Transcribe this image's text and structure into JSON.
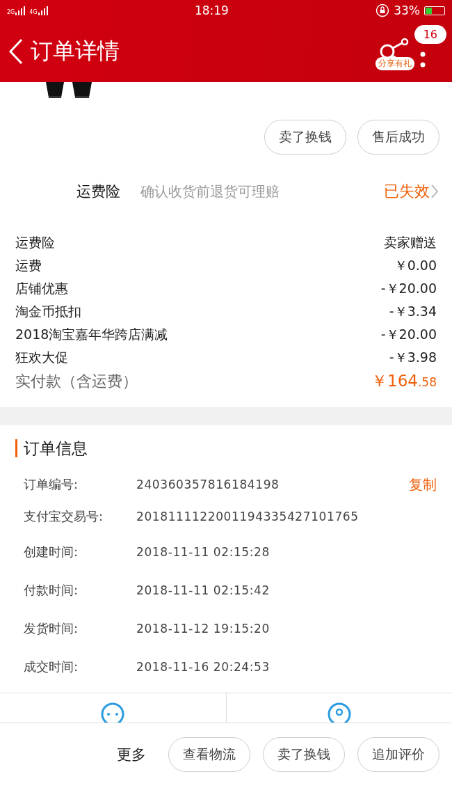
{
  "status_bar": {
    "network_1": "2G",
    "network_2": "4G",
    "time": "18:19",
    "battery": "33%"
  },
  "header": {
    "title": "订单详情",
    "share_label": "分享有礼",
    "badge": "16"
  },
  "product_actions": [
    "卖了换钱",
    "售后成功"
  ],
  "insurance": {
    "label": "运费险",
    "description": "确认收货前退货可理赔",
    "status": "已失效"
  },
  "price_rows": [
    {
      "label": "运费险",
      "value": "卖家赠送"
    },
    {
      "label": "运费",
      "value": "￥0.00"
    },
    {
      "label": "店铺优惠",
      "value": "-￥20.00"
    },
    {
      "label": "淘金币抵扣",
      "value": "-￥3.34"
    },
    {
      "label": "2018淘宝嘉年华跨店满减",
      "value": "-￥20.00"
    },
    {
      "label": "狂欢大促",
      "value": "-￥3.98"
    }
  ],
  "total": {
    "label": "实付款（含运费）",
    "amount": "￥164",
    "fraction": ".58"
  },
  "order_info": {
    "title": "订单信息",
    "rows": [
      {
        "label": "订单编号:",
        "value": "240360357816184198",
        "action": "复制"
      },
      {
        "label": "支付宝交易号:",
        "value": "2018111122001194335427101765"
      },
      {
        "label": "创建时间:",
        "value": "2018-11-11 02:15:28"
      },
      {
        "label": "付款时间:",
        "value": "2018-11-11 02:15:42"
      },
      {
        "label": "发货时间:",
        "value": "2018-11-12 19:15:20"
      },
      {
        "label": "成交时间:",
        "value": "2018-11-16 20:24:53"
      }
    ]
  },
  "bottom_bar": {
    "more": "更多",
    "buttons": [
      "查看物流",
      "卖了换钱",
      "追加评价"
    ]
  }
}
